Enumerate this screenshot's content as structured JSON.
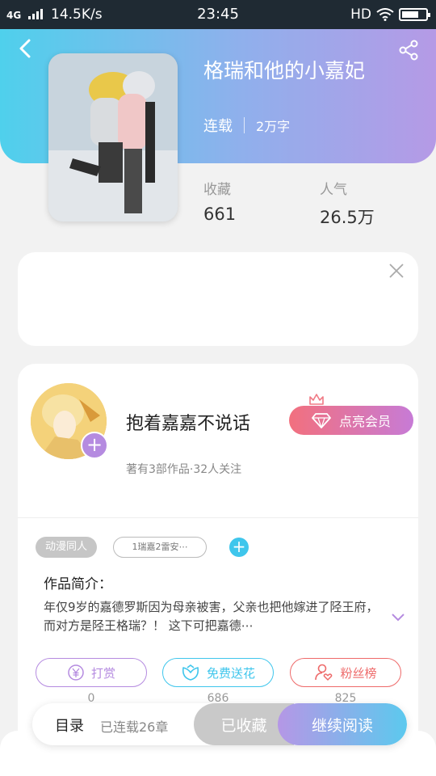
{
  "status_bar": {
    "network": "4G",
    "speed": "14.5K/s",
    "time": "23:45",
    "hd": "HD"
  },
  "book": {
    "title": "格瑞和他的小嘉妃",
    "status": "连载",
    "word_count": "2万字",
    "favorites_label": "收藏",
    "favorites_value": "661",
    "popularity_label": "人气",
    "popularity_value": "26.5万"
  },
  "author": {
    "name": "抱着嘉嘉不说话",
    "stats": "著有3部作品·32人关注",
    "vip_label": "点亮会员"
  },
  "tags": {
    "category": "动漫同人",
    "custom": "1瑞嘉2雷安⋯"
  },
  "intro": {
    "label": "作品简介：",
    "text": "年仅9岁的嘉德罗斯因为母亲被害，父亲也把他嫁进了陉王府，而对方是陉王格瑞？！ 这下可把嘉德⋯"
  },
  "actions": [
    {
      "label": "打赏",
      "count": "0",
      "color": "#b58be0"
    },
    {
      "label": "免费送花",
      "count": "686",
      "color": "#3fc6ec"
    },
    {
      "label": "粉丝榜",
      "count": "825",
      "color": "#ee6a6a"
    }
  ],
  "bottom": {
    "toc_label": "目录",
    "toc_status": "已连载26章",
    "collected_label": "已收藏",
    "continue_label": "继续阅读"
  }
}
